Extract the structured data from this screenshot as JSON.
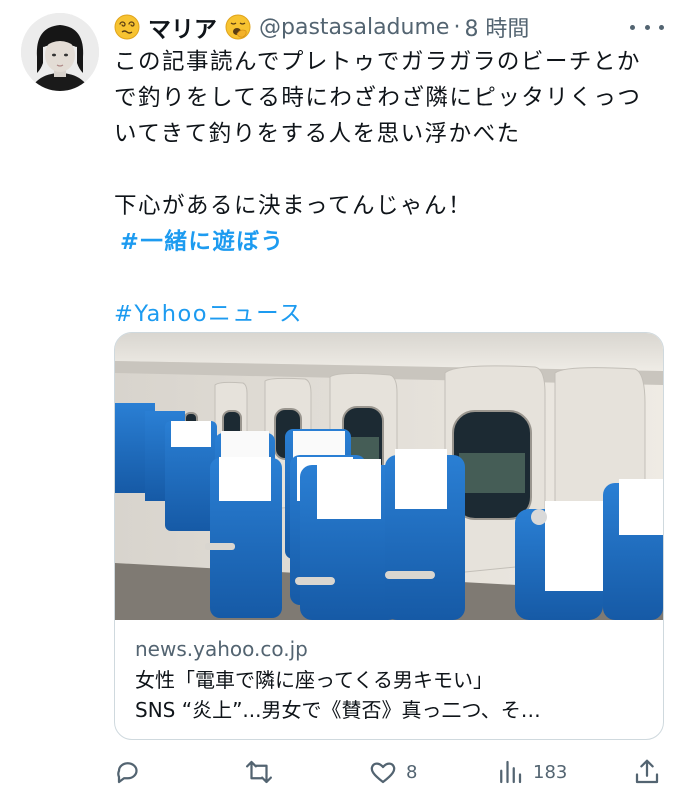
{
  "tweet": {
    "author": {
      "display_name": "マリア",
      "handle": "@pastasaladume",
      "separator": "·",
      "time": "8 時間"
    },
    "text_lines": [
      "この記事読んでプレトゥでガラガラのビーチとか",
      "で釣りをしてる時にわざわざ隣にピッタリくっつ",
      "いてきて釣りをする人を思い浮かべた",
      "",
      "下心があるに決まってんじゃん！"
    ],
    "hashtag_1": "#一緒に遊ぼう",
    "hashtag_2": "#Yahooニュース",
    "link_card": {
      "domain": "news.yahoo.co.jp",
      "title_line_1": "女性「電車で隣に座ってくる男キモい」",
      "title_line_2": "SNS “炎上”...男女で《賛否》真っ二つ、そ…"
    },
    "actions": {
      "replies": "",
      "retweets": "",
      "likes": "8",
      "views": "183"
    }
  },
  "icons": {
    "avatar": "profile-photo",
    "emoji_before_name": "dizzy-face-emoji",
    "emoji_after_name": "yawning-face-emoji",
    "more": "more-dots-icon",
    "reply": "reply-icon",
    "retweet": "retweet-icon",
    "like": "heart-icon",
    "views": "views-icon",
    "share": "share-icon"
  },
  "colors": {
    "text": "#0f1419",
    "secondary": "#536471",
    "link": "#1d9bf0",
    "card_border": "#cfd9de",
    "seat_blue": "#1f6fc4"
  }
}
